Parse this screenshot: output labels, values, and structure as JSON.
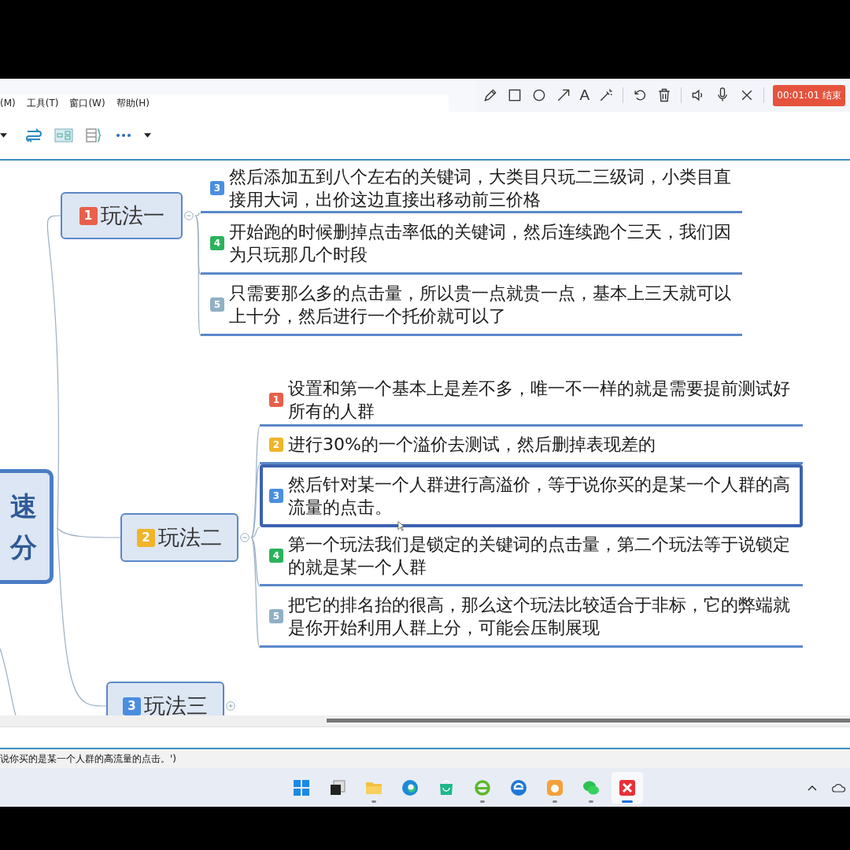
{
  "recorder_toolbar": {
    "tools": [
      {
        "kind": "pencil"
      },
      {
        "kind": "rectangle"
      },
      {
        "kind": "ellipse"
      },
      {
        "kind": "arrow"
      },
      {
        "kind": "text",
        "label": "A"
      },
      {
        "kind": "wand"
      },
      {
        "kind": "undo"
      },
      {
        "kind": "trash"
      },
      {
        "kind": "speaker"
      },
      {
        "kind": "mic"
      },
      {
        "kind": "close"
      }
    ],
    "timer": "00:01:01",
    "stop": "结束"
  },
  "menu_bar": [
    "(M)",
    "工具(T)",
    "窗口(W)",
    "帮助(H)"
  ],
  "toolbar": [
    {
      "kind": "caret"
    },
    {
      "kind": "swap"
    },
    {
      "kind": "map"
    },
    {
      "kind": "outline"
    },
    {
      "kind": "more"
    },
    {
      "kind": "caret"
    }
  ],
  "mind_map": {
    "central_topic": [
      "速",
      "分"
    ],
    "topics": [
      {
        "badge": "1",
        "color": "#e8604c",
        "title": "玩法一",
        "expanded": true,
        "items": [
          {
            "badge": "3",
            "color": "#4a8ee0",
            "text": "然后添加五到八个左右的关键词，大类目只玩二三级词，小类目直接用大词，出价这边直接出移动前三价格",
            "selected": false
          },
          {
            "badge": "4",
            "color": "#2cb35b",
            "text": "开始跑的时候删掉点击率低的关键词，然后连续跑个三天，我们因为只玩那几个时段",
            "selected": false
          },
          {
            "badge": "5",
            "color": "#8fb0c4",
            "text": "只需要那么多的点击量，所以贵一点就贵一点，基本上三天就可以上十分，然后进行一个托价就可以了",
            "selected": false
          }
        ]
      },
      {
        "badge": "2",
        "color": "#f0b428",
        "title": "玩法二",
        "expanded": true,
        "items": [
          {
            "badge": "1",
            "color": "#e8604c",
            "text": "设置和第一个基本上是差不多，唯一不一样的就是需要提前测试好所有的人群",
            "selected": false
          },
          {
            "badge": "2",
            "color": "#f0b428",
            "text": "进行30%的一个溢价去测试，然后删掉表现差的",
            "selected": false
          },
          {
            "badge": "3",
            "color": "#4a8ee0",
            "text": "然后针对某一个人群进行高溢价，等于说你买的是某一个人群的高流量的点击。",
            "selected": true
          },
          {
            "badge": "4",
            "color": "#2cb35b",
            "text": "第一个玩法我们是锁定的关键词的点击量，第二个玩法等于说锁定的就是某一个人群",
            "selected": false
          },
          {
            "badge": "5",
            "color": "#8fb0c4",
            "text": "把它的排名抬的很高，那么这个玩法比较适合于非标，它的弊端就是你开始利用人群上分，可能会压制展现",
            "selected": false
          }
        ]
      },
      {
        "badge": "3",
        "color": "#4a8ee0",
        "title": "玩法三",
        "expanded": false
      }
    ]
  },
  "status_bar": "说你买的是某一个人群的高流量的点击。')",
  "taskbar": [
    {
      "kind": "windows",
      "running": false
    },
    {
      "kind": "taskview",
      "running": false
    },
    {
      "kind": "folder",
      "running": true
    },
    {
      "kind": "edge",
      "running": false
    },
    {
      "kind": "store",
      "running": false
    },
    {
      "kind": "ie",
      "running": true
    },
    {
      "kind": "edge2",
      "running": false
    },
    {
      "kind": "uc",
      "running": true
    },
    {
      "kind": "wechat",
      "running": true
    },
    {
      "kind": "xmind",
      "running": true,
      "active": true
    }
  ]
}
